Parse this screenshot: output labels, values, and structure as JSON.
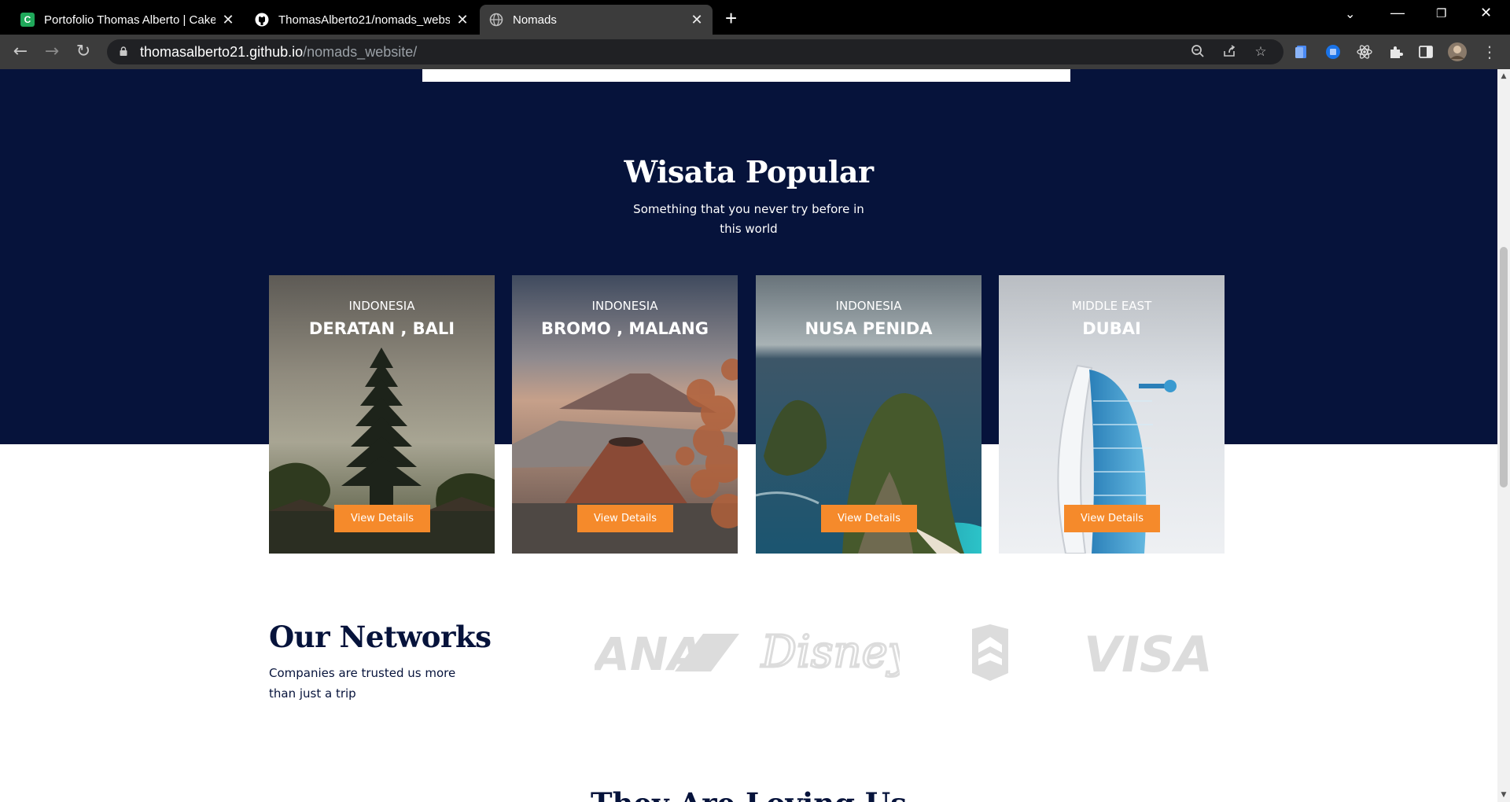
{
  "browser": {
    "tabs": [
      {
        "title": "Portofolio Thomas Alberto | Cake",
        "favicon": "c-icon"
      },
      {
        "title": "ThomasAlberto21/nomads_webs",
        "favicon": "github-icon"
      },
      {
        "title": "Nomads",
        "favicon": "globe-icon"
      }
    ],
    "url_host": "thomasalberto21.github.io",
    "url_path": "/nomads_website/"
  },
  "popular": {
    "title": "Wisata Popular",
    "subtitle": "Something that you never try before in this world",
    "cards": [
      {
        "country": "INDONESIA",
        "name": "DERATAN , BALI",
        "button": "View Details"
      },
      {
        "country": "INDONESIA",
        "name": "BROMO , MALANG",
        "button": "View Details"
      },
      {
        "country": "INDONESIA",
        "name": "NUSA PENIDA",
        "button": "View Details"
      },
      {
        "country": "MIDDLE EAST",
        "name": "DUBAI",
        "button": "View Details"
      }
    ]
  },
  "networks": {
    "title": "Our Networks",
    "subtitle": "Companies are trusted us more than just a trip",
    "logos": [
      "ANA",
      "Disney",
      "VISA"
    ]
  },
  "next_section": {
    "title": "They Are Loving Us"
  },
  "colors": {
    "navy": "#06133b",
    "accent": "#f58a2b"
  }
}
